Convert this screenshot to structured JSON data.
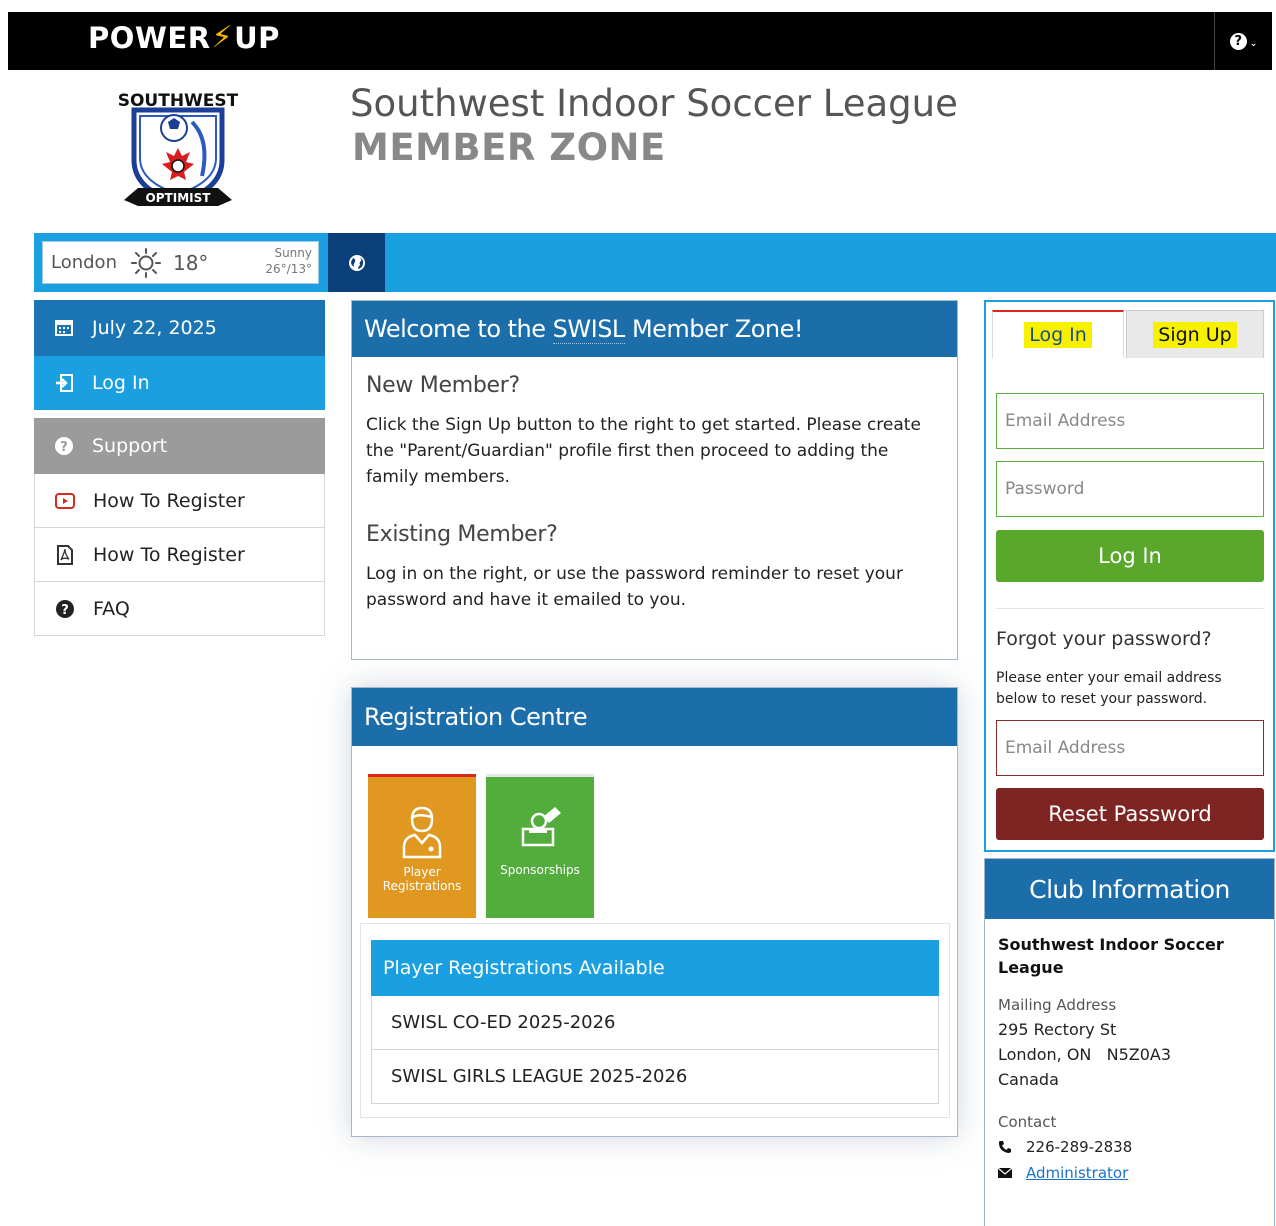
{
  "brand": {
    "left": "POWER",
    "right": "UP"
  },
  "header": {
    "logo_top_text": "SOUTHWEST",
    "logo_bottom_text": "OPTIMIST",
    "title": "Southwest Indoor Soccer League",
    "subtitle": "MEMBER ZONE"
  },
  "weather": {
    "city": "London",
    "temp": "18°",
    "condition": "Sunny",
    "range": "26°/13°"
  },
  "nav": {
    "date": "July 22, 2025",
    "login": "Log In",
    "support": "Support",
    "items": [
      {
        "label": "How To Register",
        "icon": "youtube-icon"
      },
      {
        "label": "How To Register",
        "icon": "pdf-icon"
      },
      {
        "label": "FAQ",
        "icon": "question-circle-icon"
      }
    ]
  },
  "welcome": {
    "title_pre": "Welcome to the ",
    "title_abbr": "SWISL",
    "title_post": " Member Zone!",
    "new_heading": "New Member?",
    "new_text": "Click the Sign Up button to the right to get started. Please create the \"Parent/Guardian\" profile first then proceed to adding the family members.",
    "existing_heading": "Existing Member?",
    "existing_text": "Log in on the right, or use the password reminder to reset your password and have it emailed to you."
  },
  "registration": {
    "title": "Registration Centre",
    "tiles": [
      {
        "label": "Player Registrations",
        "icon": "player-icon"
      },
      {
        "label": "Sponsorships",
        "icon": "donation-icon"
      }
    ],
    "list_header": "Player Registrations Available",
    "programs": [
      "SWISL CO-ED 2025-2026",
      "SWISL GIRLS LEAGUE 2025-2026"
    ]
  },
  "login": {
    "tab_login": "Log In",
    "tab_signup": "Sign Up",
    "email_placeholder": "Email Address",
    "password_placeholder": "Password",
    "login_button": "Log In",
    "forgot_heading": "Forgot your password?",
    "forgot_text": "Please enter your email address below to reset your password.",
    "reset_email_placeholder": "Email Address",
    "reset_button": "Reset Password"
  },
  "club": {
    "title": "Club Information",
    "name": "Southwest Indoor Soccer League",
    "mailing_label": "Mailing Address",
    "street": "295 Rectory St",
    "city_line": "London, ON   N5Z0A3",
    "country": "Canada",
    "contact_label": "Contact",
    "phone": "226-289-2838",
    "email_link": "Administrator"
  },
  "colors": {
    "accent_blue": "#1a9fe0",
    "dark_blue": "#1b6eaa",
    "green": "#59a82c",
    "red": "#7e2523",
    "orange": "#e09820",
    "highlight": "#f7f100"
  }
}
